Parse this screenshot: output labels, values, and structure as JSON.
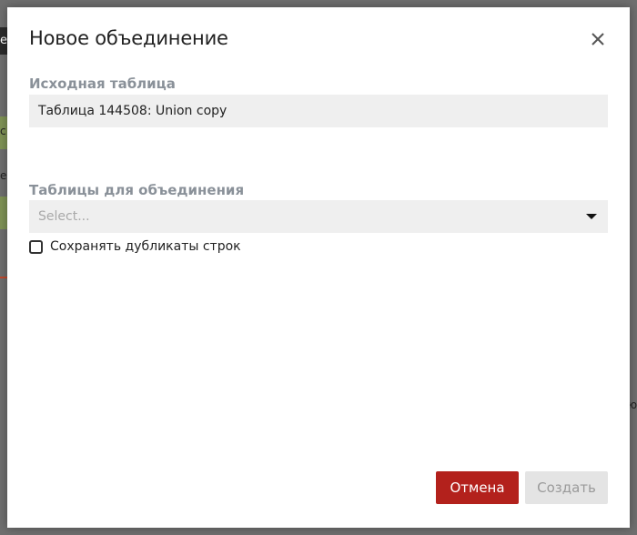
{
  "background": {
    "top_text": "ел",
    "side_text_1": "с",
    "side_text_2": "е",
    "side_text_3": "ю:"
  },
  "dialog": {
    "title": "Новое объединение",
    "source_table": {
      "label": "Исходная таблица",
      "value": "Таблица 144508: Union copy"
    },
    "union_tables": {
      "label": "Таблицы для объединения",
      "placeholder": "Select..."
    },
    "keep_duplicates": {
      "label": "Сохранять дубликаты строк",
      "checked": false
    },
    "buttons": {
      "cancel": "Отмена",
      "create": "Создать"
    }
  },
  "colors": {
    "cancel_bg": "#b3211c",
    "create_bg": "#e4e4e4",
    "field_bg": "#efefef",
    "label": "#8a9199"
  }
}
